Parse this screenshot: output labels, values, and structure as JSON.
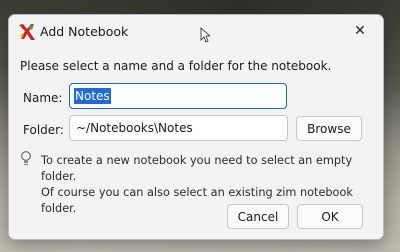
{
  "window": {
    "title": "Add Notebook",
    "close_glyph": "✕",
    "icon": "zim-app-icon"
  },
  "instruction": "Please select a name and a folder for the notebook.",
  "form": {
    "name_label": "Name:",
    "name_value": "Notes",
    "folder_label": "Folder:",
    "folder_value": "~/Notebooks\\Notes",
    "browse_label": "Browse"
  },
  "hint": {
    "icon": "lightbulb-icon",
    "line1": "To create a new notebook you need to select an empty folder.",
    "line2": "Of course you can also select an existing zim notebook folder."
  },
  "buttons": {
    "cancel": "Cancel",
    "ok": "OK"
  },
  "colors": {
    "selection": "#1e6ad6",
    "focus_border": "#1e66c8"
  }
}
